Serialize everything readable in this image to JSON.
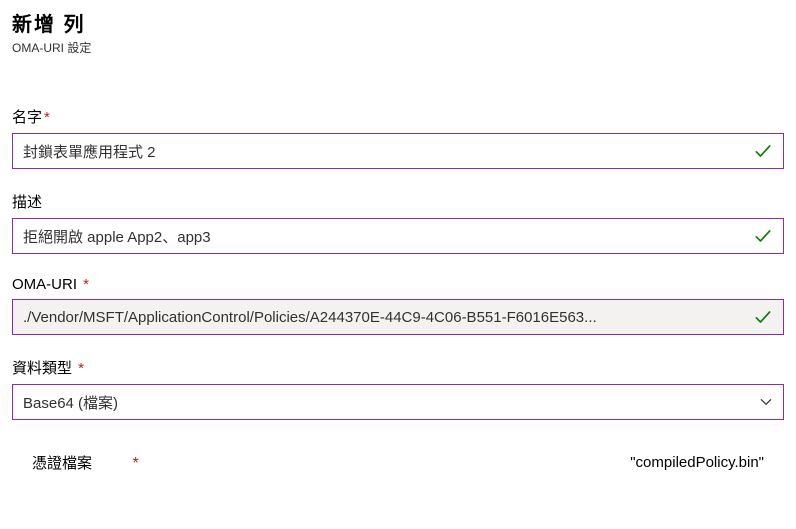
{
  "header": {
    "title": "新增  列",
    "subtitle": "OMA-URI 設定"
  },
  "fields": {
    "name": {
      "label": "名字",
      "required": "*",
      "value": "封鎖表單應用程式 2"
    },
    "description": {
      "label": "描述",
      "value": "拒絕開啟 apple App2、app3"
    },
    "omaUri": {
      "label": "OMA-URI ",
      "required": "*",
      "value": "./Vendor/MSFT/ApplicationControl/Policies/A244370E-44C9-4C06-B551-F6016E563..."
    },
    "dataType": {
      "label": "資料類型 ",
      "required": "*",
      "value": "Base64 (檔案)"
    },
    "certFile": {
      "label": "憑證檔案",
      "required": "*",
      "fileName": "\"compiledPolicy.bin\""
    }
  }
}
